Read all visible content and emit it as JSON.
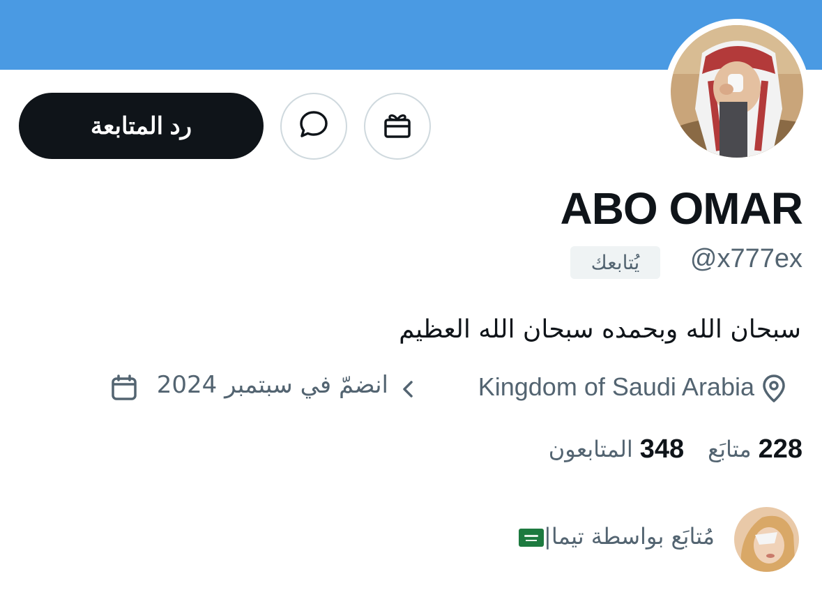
{
  "profile": {
    "display_name": "ABO OMAR",
    "handle": "@x777ex",
    "follows_you_badge": "يُتابعك",
    "bio": "سبحان الله وبحمده سبحان الله العظيم",
    "location": "Kingdom of Saudi Arabia",
    "joined": "انضمّ في سبتمبر 2024"
  },
  "actions": {
    "follow_back_label": "رد المتابعة",
    "message_icon": "message-icon",
    "gift_icon": "gift-icon"
  },
  "stats": {
    "following_count": "228",
    "following_label": "متابَع",
    "followers_count": "348",
    "followers_label": "المتابعون"
  },
  "followed_by": {
    "text": "مُتابَع بواسطة تيما|"
  },
  "colors": {
    "banner": "#4a9ae3",
    "primary_text": "#0f1419",
    "secondary_text": "#536471",
    "button_dark": "#0f1419",
    "border": "#cfd9de"
  }
}
